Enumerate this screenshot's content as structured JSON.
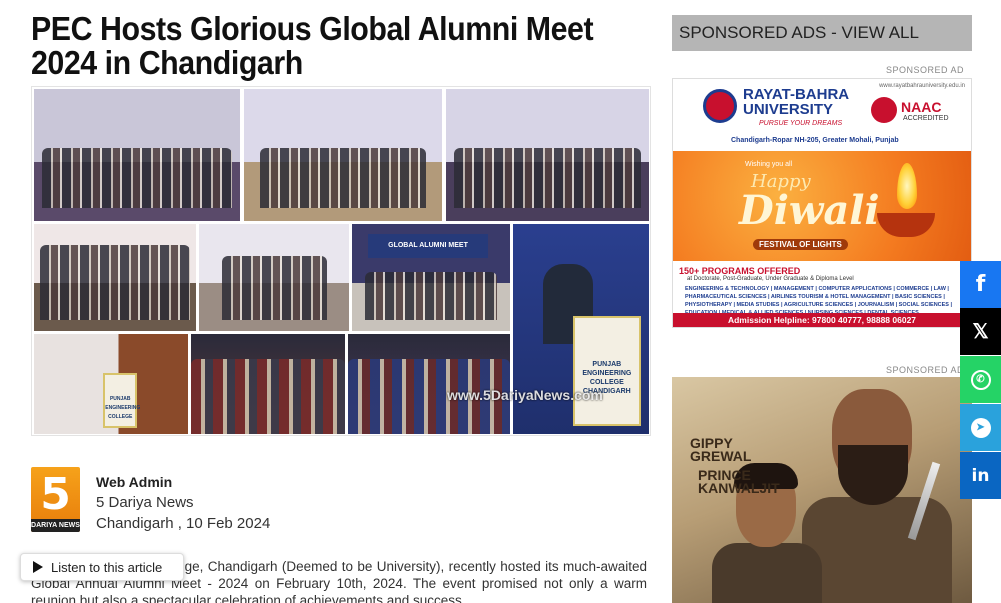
{
  "article": {
    "title": "PEC Hosts Glorious Global Alumni Meet 2024 in Chandigarh",
    "watermark": "www.5DariyaNews.com",
    "podium_text": "PUNJAB ENGINEERING COLLEGE CHANDIGARH",
    "banner_text": "GLOBAL ALUMNI MEET",
    "author": {
      "logo_number": "5",
      "logo_brand": "DARIYA NEWS",
      "name": "Web Admin",
      "org": "5 Dariya News",
      "dateline": "Chandigarh , 10 Feb 2024"
    },
    "body_text": "Punjab Engineering College, Chandigarh (Deemed to be University), recently hosted its much-awaited Global Annual Alumni Meet - 2024 on February 10th, 2024. The event promised not only a warm reunion but also a spectacular celebration of achievements and success.",
    "listen_label": "Listen to this article"
  },
  "sidebar": {
    "sponsored_header": "SPONSORED ADS - VIEW ALL",
    "ad_label": "SPONSORED AD",
    "ad1": {
      "university": "RAYAT-BAHRA UNIVERSITY",
      "tagline": "PURSUE YOUR DREAMS",
      "location": "Chandigarh-Ropar NH-205, Greater Mohali, Punjab",
      "url": "www.rayatbahrauniversity.edu.in",
      "naac": "NAAC",
      "naac_sub": "ACCREDITED",
      "wish": "Wishing you all",
      "happy": "Happy",
      "diwali": "Diwali",
      "festival": "FESTIVAL OF LIGHTS",
      "programs": "150+ PROGRAMS OFFERED",
      "programs_sub": "at Doctorate, Post-Graduate, Under Graduate & Diploma Level",
      "program_list": "ENGINEERING & TECHNOLOGY | MANAGEMENT | COMPUTER APPLICATIONS | COMMERCE | LAW | PHARMACEUTICAL SCIENCES | AIRLINES TOURISM & HOTEL MANAGEMENT | BASIC SCIENCES | PHYSIOTHERAPY | MEDIA STUDIES | AGRICULTURE SCIENCES | JOURNALISM | SOCIAL SCIENCES | EDUCATION | MEDICAL & ALLIED SCIENCES | NURSING SCIENCES | DENTAL SCIENCES",
      "helpline": "Admission Helpline: 97800 40777, 98888 06027"
    },
    "ad2": {
      "actor1": "GIPPY GREWAL",
      "actor2": "PRINCE KANWALJIT"
    }
  },
  "share": {
    "facebook": "f",
    "x": "𝕏",
    "whatsapp": "✆",
    "telegram": "➤",
    "linkedin": "in"
  },
  "icons": {
    "play": "play-icon",
    "facebook": "facebook-icon",
    "x": "x-icon",
    "whatsapp": "whatsapp-icon",
    "telegram": "telegram-icon",
    "linkedin": "linkedin-icon"
  },
  "colors": {
    "facebook": "#1877f2",
    "x": "#000000",
    "whatsapp": "#25d366",
    "telegram": "#2aa2dc",
    "linkedin": "#0a66c2",
    "sponsored_bar": "#b5b5b5"
  }
}
